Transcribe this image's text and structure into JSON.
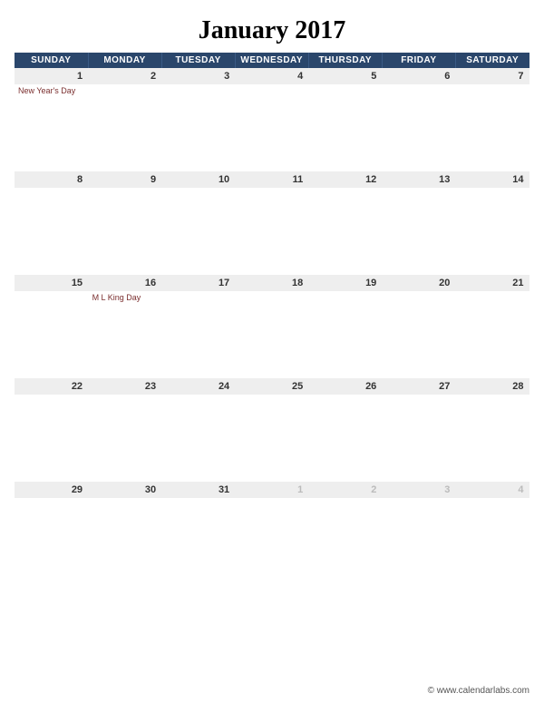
{
  "title": "January 2017",
  "day_headers": [
    "SUNDAY",
    "MONDAY",
    "TUESDAY",
    "WEDNESDAY",
    "THURSDAY",
    "FRIDAY",
    "SATURDAY"
  ],
  "weeks": [
    {
      "nums": [
        "1",
        "2",
        "3",
        "4",
        "5",
        "6",
        "7"
      ],
      "other": [
        false,
        false,
        false,
        false,
        false,
        false,
        false
      ],
      "events": [
        "New Year's Day",
        "",
        "",
        "",
        "",
        "",
        ""
      ]
    },
    {
      "nums": [
        "8",
        "9",
        "10",
        "11",
        "12",
        "13",
        "14"
      ],
      "other": [
        false,
        false,
        false,
        false,
        false,
        false,
        false
      ],
      "events": [
        "",
        "",
        "",
        "",
        "",
        "",
        ""
      ]
    },
    {
      "nums": [
        "15",
        "16",
        "17",
        "18",
        "19",
        "20",
        "21"
      ],
      "other": [
        false,
        false,
        false,
        false,
        false,
        false,
        false
      ],
      "events": [
        "",
        "M L King Day",
        "",
        "",
        "",
        "",
        ""
      ]
    },
    {
      "nums": [
        "22",
        "23",
        "24",
        "25",
        "26",
        "27",
        "28"
      ],
      "other": [
        false,
        false,
        false,
        false,
        false,
        false,
        false
      ],
      "events": [
        "",
        "",
        "",
        "",
        "",
        "",
        ""
      ]
    },
    {
      "nums": [
        "29",
        "30",
        "31",
        "1",
        "2",
        "3",
        "4"
      ],
      "other": [
        false,
        false,
        false,
        true,
        true,
        true,
        true
      ],
      "events": [
        "",
        "",
        "",
        "",
        "",
        "",
        ""
      ]
    }
  ],
  "footer": "© www.calendarlabs.com"
}
